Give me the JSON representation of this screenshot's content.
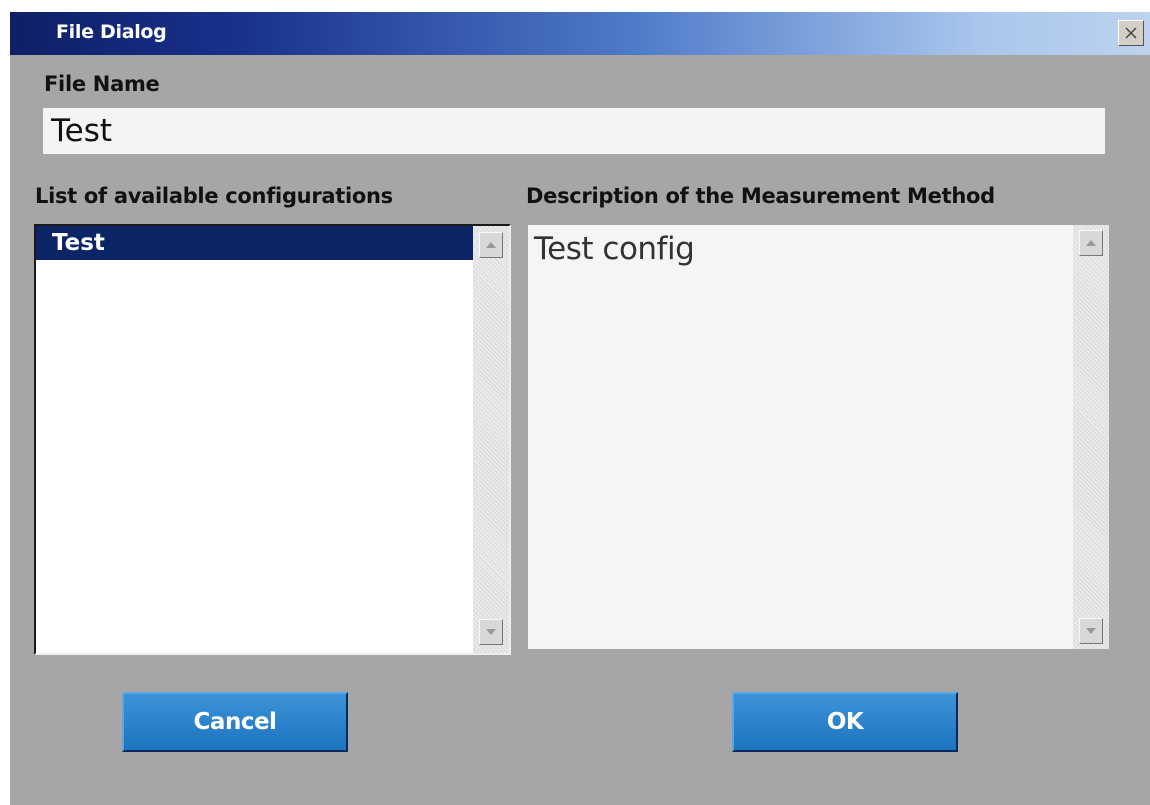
{
  "window": {
    "title": "File Dialog",
    "close_icon": "close-icon"
  },
  "file_name": {
    "label": "File Name",
    "value": "Test"
  },
  "configurations": {
    "label": "List of available configurations",
    "items": [
      "Test"
    ],
    "selected_index": 0
  },
  "description": {
    "label": "Description of the Measurement Method",
    "text": "Test config"
  },
  "buttons": {
    "cancel_label": "Cancel",
    "ok_label": "OK"
  },
  "colors": {
    "window_bg": "#a6a6a6",
    "title_gradient_start": "#0e1f66",
    "selection": "#0b2466",
    "button": "#1c74bf"
  }
}
